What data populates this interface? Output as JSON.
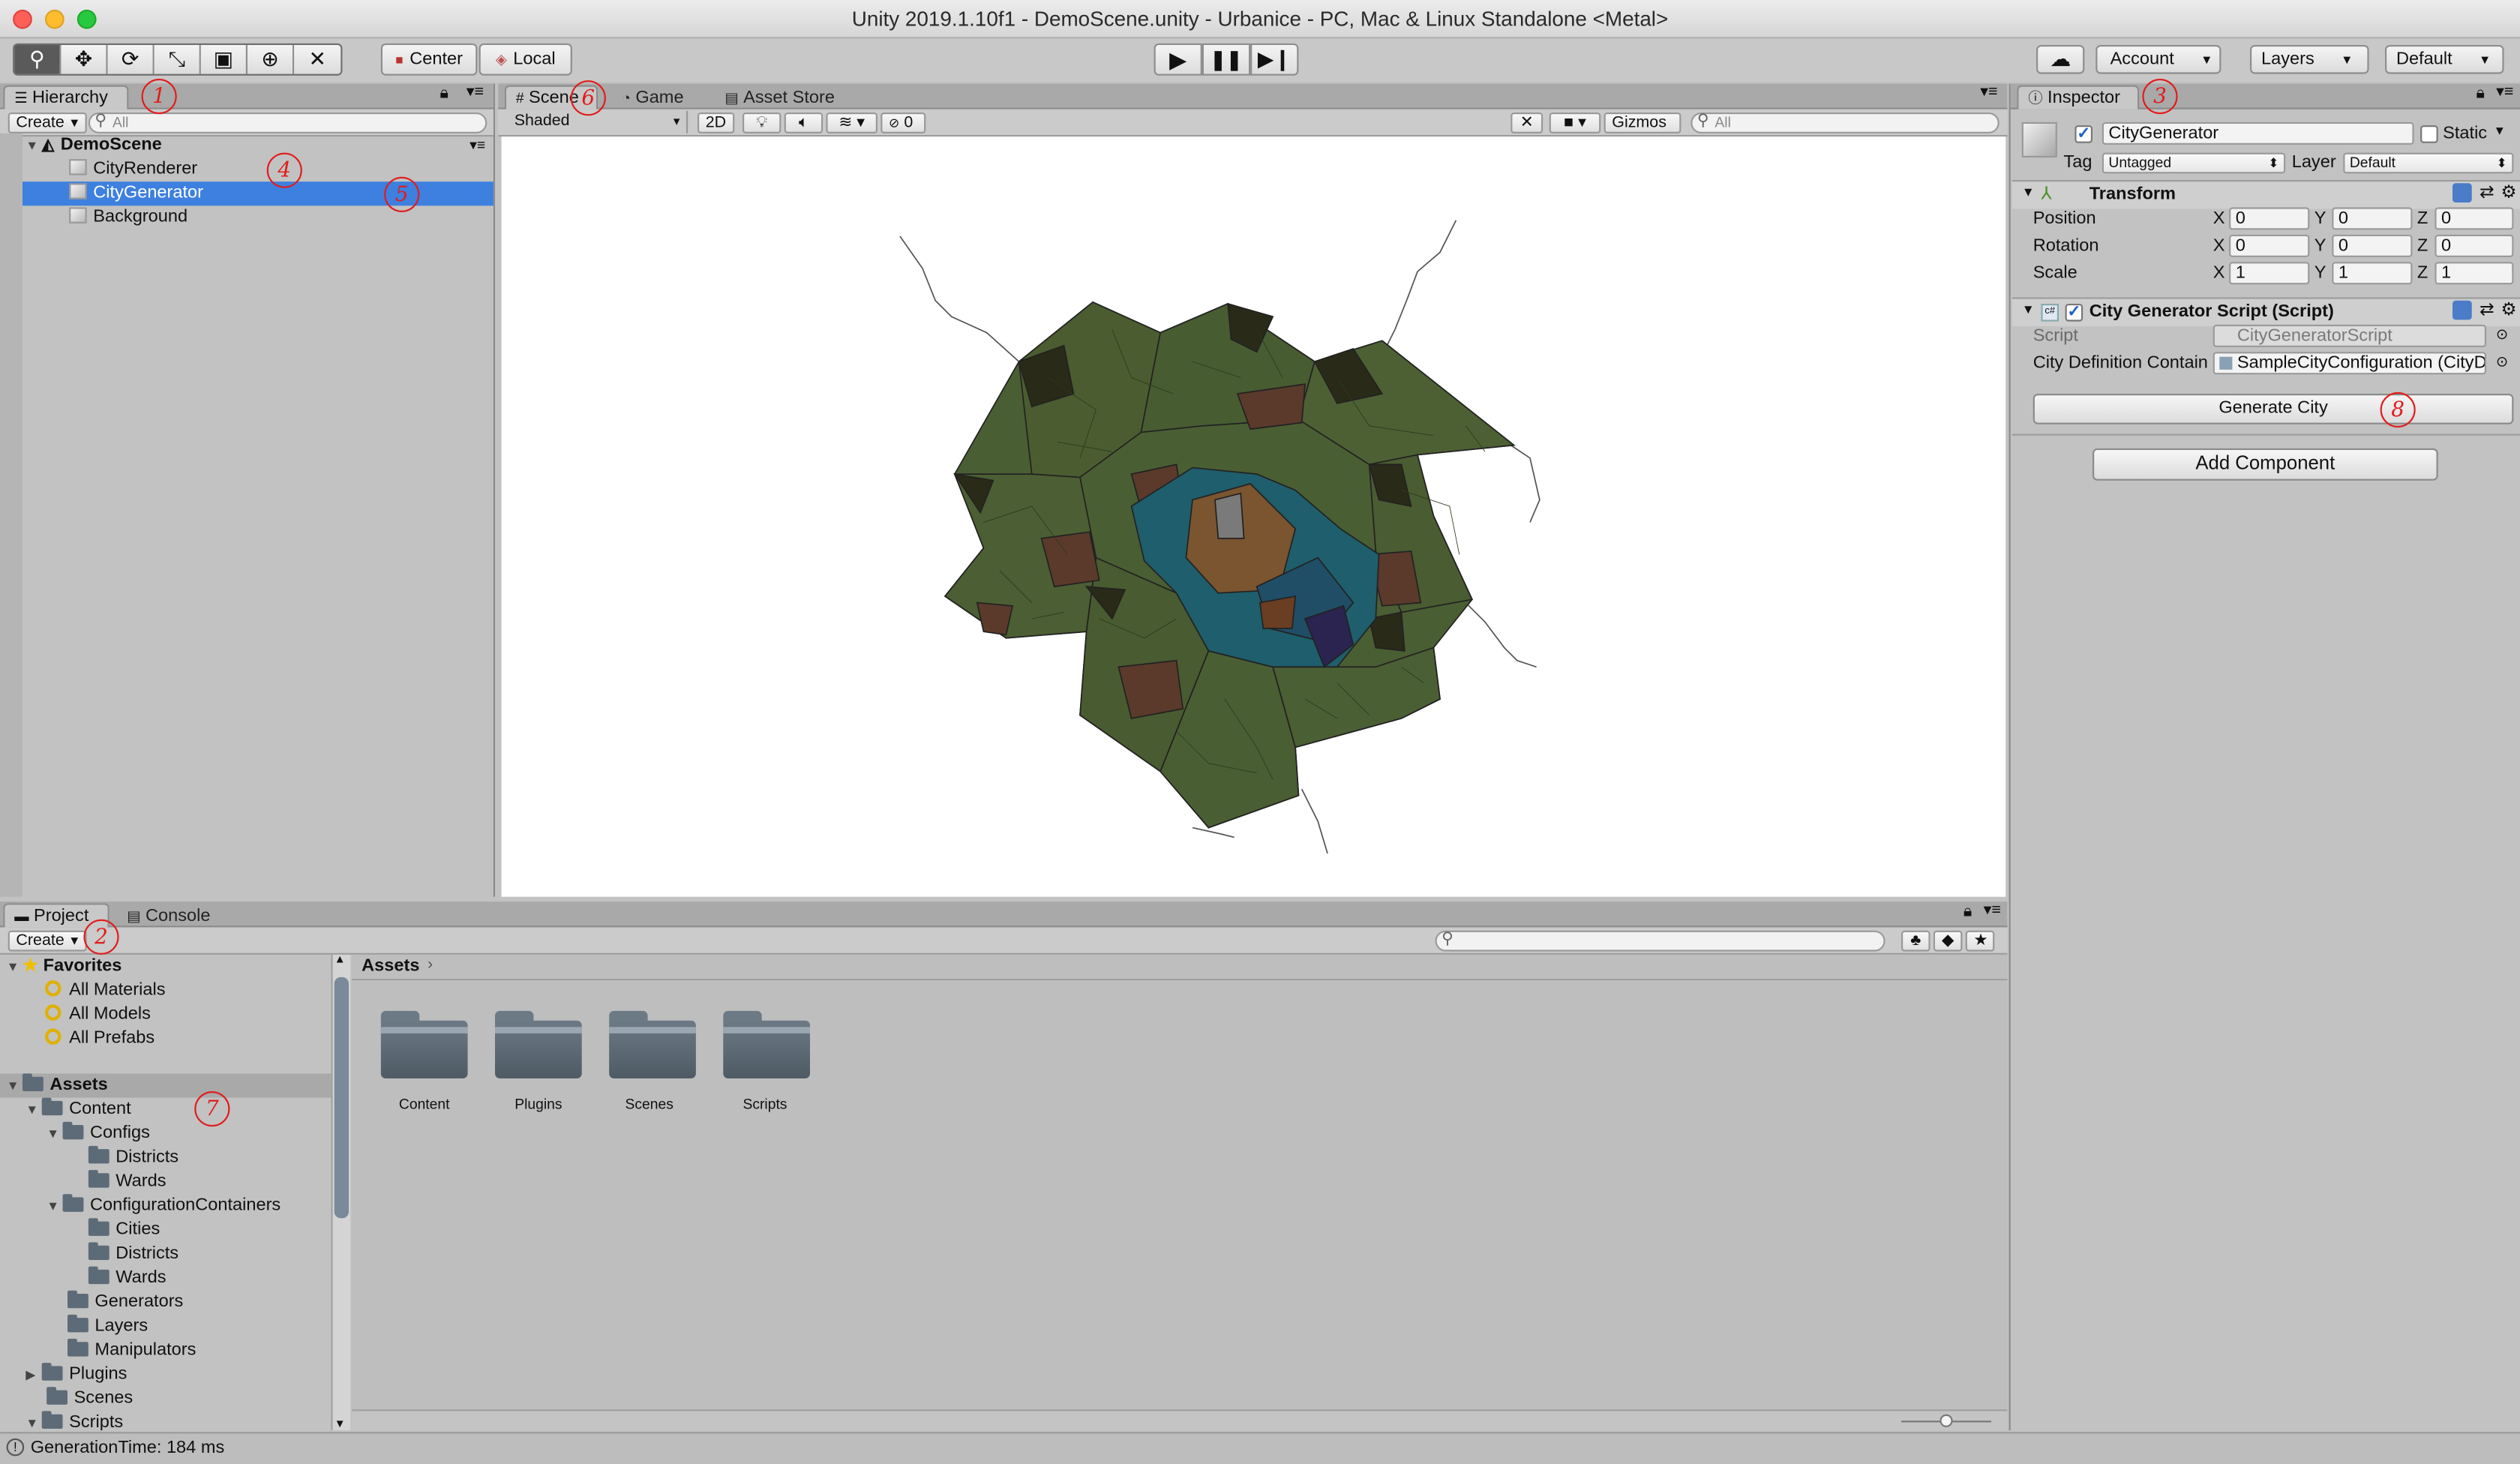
{
  "window": {
    "title": "Unity 2019.1.10f1 - DemoScene.unity - Urbanice - PC, Mac & Linux Standalone <Metal>"
  },
  "toolbar": {
    "pivot_center": "Center",
    "pivot_local": "Local",
    "account": "Account",
    "layers": "Layers",
    "layout": "Default"
  },
  "hierarchy": {
    "tab": "Hierarchy",
    "create": "Create",
    "search_placeholder": "All",
    "scene": "DemoScene",
    "items": [
      "CityRenderer",
      "CityGenerator",
      "Background"
    ]
  },
  "scene_view": {
    "tabs": [
      "Scene",
      "Game",
      "Asset Store"
    ],
    "shading": "Shaded",
    "mode_2d": "2D",
    "hidden_count": "0",
    "gizmos": "Gizmos",
    "search_placeholder": "All"
  },
  "inspector": {
    "tab": "Inspector",
    "object_name": "CityGenerator",
    "static_label": "Static",
    "tag_label": "Tag",
    "tag_value": "Untagged",
    "layer_label": "Layer",
    "layer_value": "Default",
    "transform": {
      "title": "Transform",
      "rows": [
        {
          "label": "Position",
          "x": "0",
          "y": "0",
          "z": "0"
        },
        {
          "label": "Rotation",
          "x": "0",
          "y": "0",
          "z": "0"
        },
        {
          "label": "Scale",
          "x": "1",
          "y": "1",
          "z": "1"
        }
      ]
    },
    "script_component": {
      "title": "City Generator Script (Script)",
      "script_label": "Script",
      "script_value": "CityGeneratorScript",
      "container_label": "City Definition Contain",
      "container_value": "SampleCityConfiguration (CityD"
    },
    "generate_button": "Generate City",
    "add_component": "Add Component"
  },
  "project": {
    "tabs": [
      "Project",
      "Console"
    ],
    "create": "Create",
    "favorites": "Favorites",
    "favorite_items": [
      "All Materials",
      "All Models",
      "All Prefabs"
    ],
    "assets_root": "Assets",
    "tree": [
      {
        "label": "Content",
        "depth": 1,
        "expanded": true
      },
      {
        "label": "Configs",
        "depth": 2,
        "expanded": true
      },
      {
        "label": "Districts",
        "depth": 3
      },
      {
        "label": "Wards",
        "depth": 3
      },
      {
        "label": "ConfigurationContainers",
        "depth": 2,
        "expanded": true
      },
      {
        "label": "Cities",
        "depth": 3
      },
      {
        "label": "Districts",
        "depth": 3
      },
      {
        "label": "Wards",
        "depth": 3
      },
      {
        "label": "Generators",
        "depth": 2
      },
      {
        "label": "Layers",
        "depth": 2
      },
      {
        "label": "Manipulators",
        "depth": 2
      },
      {
        "label": "Plugins",
        "depth": 1,
        "collapsed": true
      },
      {
        "label": "Scenes",
        "depth": 1
      },
      {
        "label": "Scripts",
        "depth": 1,
        "expanded": true
      }
    ],
    "breadcrumb": "Assets",
    "folders": [
      "Content",
      "Plugins",
      "Scenes",
      "Scripts"
    ]
  },
  "status_bar": {
    "text": "GenerationTime: 184 ms"
  },
  "annotations": [
    "1",
    "2",
    "3",
    "4",
    "5",
    "6",
    "7",
    "8"
  ],
  "colors": {
    "selection": "#3d80df",
    "annotation": "#e21b1b",
    "district_green": "#4a5e33",
    "district_brown": "#5b3a2c",
    "district_teal": "#1f5e6c",
    "district_ochre": "#7a5530",
    "district_dark": "#2a2a1a"
  }
}
